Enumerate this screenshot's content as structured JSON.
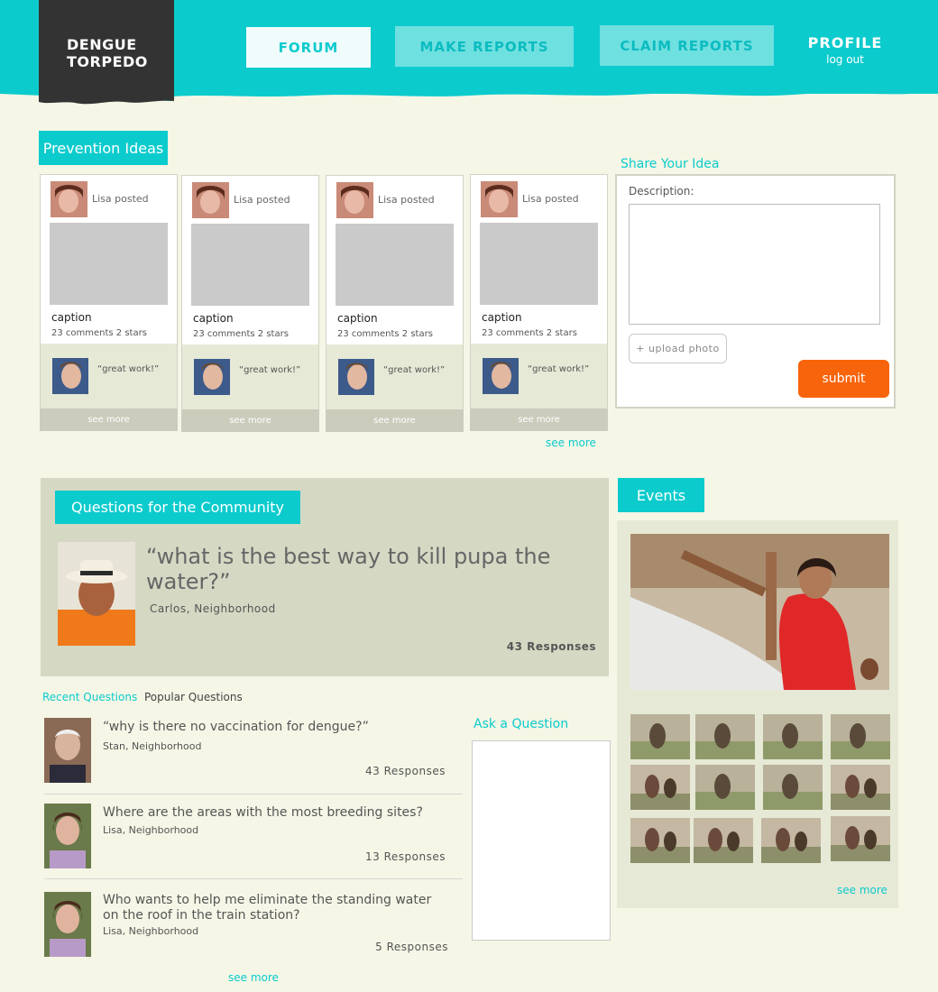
{
  "header": {
    "logo_line1": "DENGUE",
    "logo_line2": "TORPEDO",
    "nav": {
      "forum": "FORUM",
      "make_reports": "MAKE REPORTS",
      "claim_reports": "CLAIM REPORTS"
    },
    "profile": "PROFILE",
    "logout": "log out"
  },
  "prevention": {
    "title": "Prevention Ideas",
    "cards": [
      {
        "posted": "Lisa posted",
        "caption": "caption",
        "stats": "23 comments 2 stars",
        "comment": "“great work!”",
        "see_more": "see more"
      },
      {
        "posted": "Lisa posted",
        "caption": "caption",
        "stats": "23 comments 2 stars",
        "comment": "“great work!”",
        "see_more": "see more"
      },
      {
        "posted": "Lisa posted",
        "caption": "caption",
        "stats": "23 comments 2 stars",
        "comment": "“great work!”",
        "see_more": "see more"
      },
      {
        "posted": "Lisa posted",
        "caption": "caption",
        "stats": "23 comments 2 stars",
        "comment": "“great work!”",
        "see_more": "see more"
      }
    ],
    "see_more": "see more"
  },
  "share": {
    "title": "Share Your Idea",
    "description_label": "Description:",
    "upload": "+ upload photo",
    "submit": "submit"
  },
  "questions": {
    "title": "Questions for the Community",
    "featured": {
      "text": "“what is the best way to kill pupa the water?”",
      "author": "Carlos, Neighborhood",
      "responses": "43 Responses"
    },
    "tabs": {
      "recent": "Recent Questions",
      "popular": "Popular Questions"
    },
    "list": [
      {
        "text": "“why is there no vaccination for dengue?”",
        "author": "Stan, Neighborhood",
        "responses": "43 Responses"
      },
      {
        "text": "Where are the areas with the most breeding sites?",
        "author": "Lisa, Neighborhood",
        "responses": "13 Responses"
      },
      {
        "text": "Who wants to help me eliminate the standing water on the roof in the train station?",
        "author": "Lisa, Neighborhood",
        "responses": "5 Responses"
      }
    ],
    "see_more": "see more",
    "ask_title": "Ask a Question"
  },
  "events": {
    "title": "Events",
    "see_more": "see more"
  },
  "colors": {
    "accent": "#0ccbcd",
    "submit": "#f8640b",
    "logo_bg": "#333333",
    "page_bg": "#f5f6e6"
  }
}
